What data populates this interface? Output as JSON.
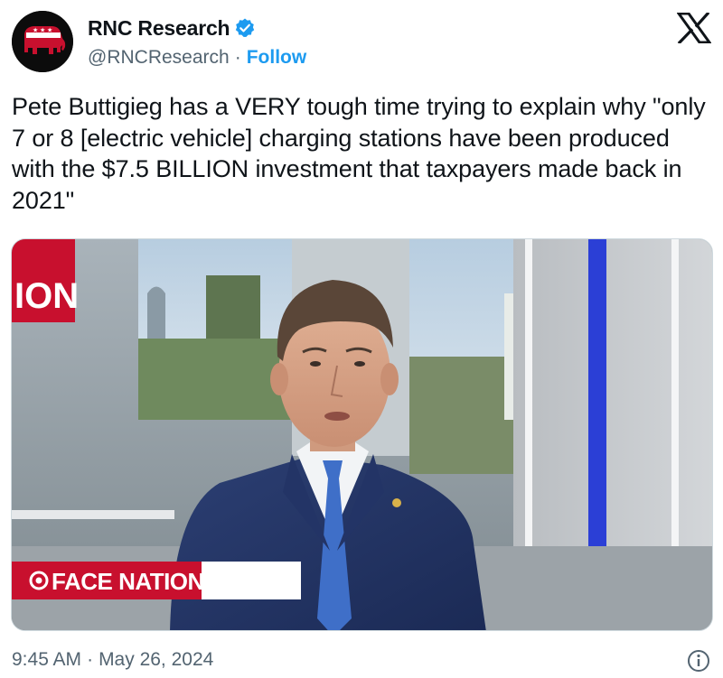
{
  "author": {
    "display_name": "RNC Research",
    "handle": "@RNCResearch",
    "separator": "·",
    "follow_label": "Follow",
    "verified": true,
    "avatar_icon": "republican-elephant-logo"
  },
  "brand": {
    "icon": "x-logo"
  },
  "tweet": {
    "text": "Pete Buttigieg has a VERY tough time trying to explain why \"only 7 or 8 [electric vehicle] charging stations have been produced with the $7.5 BILLION investment that taxpayers made back in 2021\""
  },
  "media": {
    "lower_third": "FACE NATION",
    "lower_third_logo": "cbs-eye-logo",
    "background_sign": "ION"
  },
  "footer": {
    "time": "9:45 AM",
    "separator": "·",
    "date": "May 26, 2024",
    "info_icon": "info-icon"
  },
  "colors": {
    "accent": "#1d9bf0",
    "text_primary": "#0f1419",
    "text_secondary": "#536471",
    "gop_red": "#c8102e",
    "lower_third_red": "#c8102e"
  }
}
